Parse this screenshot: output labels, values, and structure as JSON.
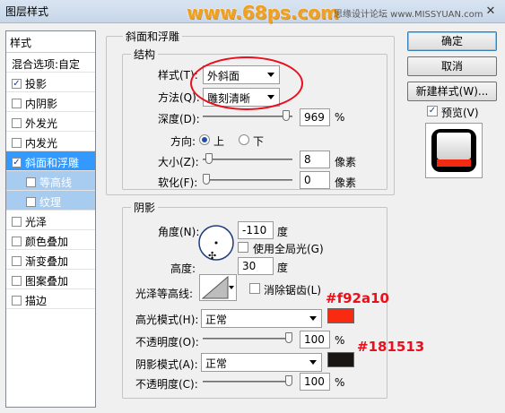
{
  "window": {
    "title": "图层样式",
    "watermark": "www.68ps.com",
    "site_tag": "思缘设计论坛 www.MISSYUAN.com",
    "close": "✕"
  },
  "style_list": {
    "header": "样式",
    "items": [
      {
        "label": "混合选项:自定",
        "checkbox": false,
        "checked": false,
        "sub": false,
        "state": "normal"
      },
      {
        "label": "投影",
        "checkbox": true,
        "checked": true,
        "sub": false,
        "state": "normal"
      },
      {
        "label": "内阴影",
        "checkbox": true,
        "checked": false,
        "sub": false,
        "state": "normal"
      },
      {
        "label": "外发光",
        "checkbox": true,
        "checked": false,
        "sub": false,
        "state": "normal"
      },
      {
        "label": "内发光",
        "checkbox": true,
        "checked": false,
        "sub": false,
        "state": "normal"
      },
      {
        "label": "斜面和浮雕",
        "checkbox": true,
        "checked": true,
        "sub": false,
        "state": "selected"
      },
      {
        "label": "等高线",
        "checkbox": true,
        "checked": false,
        "sub": true,
        "state": "sub-selected"
      },
      {
        "label": "纹理",
        "checkbox": true,
        "checked": false,
        "sub": true,
        "state": "sub-selected"
      },
      {
        "label": "光泽",
        "checkbox": true,
        "checked": false,
        "sub": false,
        "state": "normal"
      },
      {
        "label": "颜色叠加",
        "checkbox": true,
        "checked": false,
        "sub": false,
        "state": "normal"
      },
      {
        "label": "渐变叠加",
        "checkbox": true,
        "checked": false,
        "sub": false,
        "state": "normal"
      },
      {
        "label": "图案叠加",
        "checkbox": true,
        "checked": false,
        "sub": false,
        "state": "normal"
      },
      {
        "label": "描边",
        "checkbox": true,
        "checked": false,
        "sub": false,
        "state": "normal"
      }
    ]
  },
  "bevel": {
    "section_title": "斜面和浮雕",
    "structure_title": "结构",
    "style_label": "样式(T):",
    "style_value": "外斜面",
    "technique_label": "方法(Q):",
    "technique_value": "雕刻清晰",
    "depth_label": "深度(D):",
    "depth_value": "969",
    "depth_unit": "%",
    "depth_level": 0.97,
    "direction_label": "方向:",
    "direction_up": "上",
    "direction_down": "下",
    "size_label": "大小(Z):",
    "size_value": "8",
    "size_unit": "像素",
    "size_level": 0.03,
    "soften_label": "软化(F):",
    "soften_value": "0",
    "soften_unit": "像素",
    "soften_level": 0.0
  },
  "shading": {
    "title": "阴影",
    "angle_label": "角度(N):",
    "angle_value": "-110",
    "angle_unit": "度",
    "global_light_label": "使用全局光(G)",
    "altitude_label": "高度:",
    "altitude_value": "30",
    "altitude_unit": "度",
    "gloss_contour_label": "光泽等高线:",
    "antialias_label": "消除锯齿(L)",
    "highlight_mode_label": "高光模式(H):",
    "highlight_mode_value": "正常",
    "highlight_color": "#f92a10",
    "highlight_opacity_label": "不透明度(O):",
    "highlight_opacity_value": "100",
    "highlight_opacity_unit": "%",
    "highlight_opacity_level": 1.0,
    "shadow_mode_label": "阴影模式(A):",
    "shadow_mode_value": "正常",
    "shadow_color": "#181513",
    "shadow_opacity_label": "不透明度(C):",
    "shadow_opacity_value": "100",
    "shadow_opacity_unit": "%",
    "shadow_opacity_level": 1.0
  },
  "annotations": {
    "highlight_hex": "#f92a10",
    "shadow_hex": "#181513"
  },
  "buttons": {
    "ok": "确定",
    "cancel": "取消",
    "new_style": "新建样式(W)...",
    "preview_label": "预览(V)"
  }
}
